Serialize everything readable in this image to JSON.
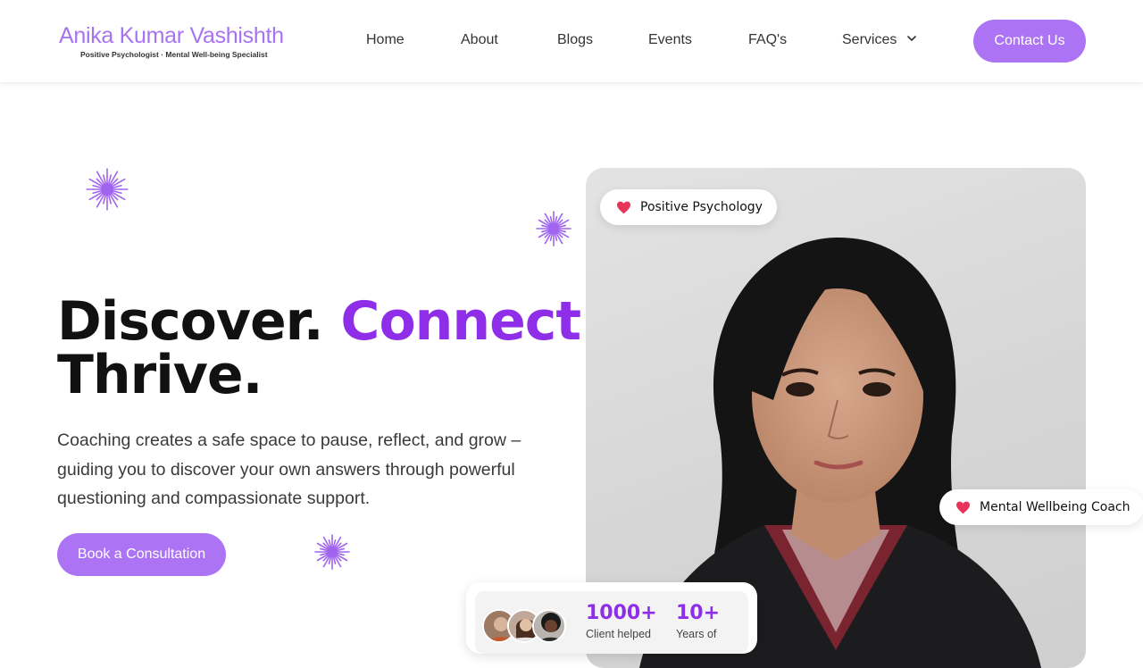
{
  "brand": {
    "name": "Anika Kumar Vashishth",
    "tagline": "Positive Psychologist · Mental Well-being Specialist"
  },
  "nav": {
    "items": [
      "Home",
      "About",
      "Blogs",
      "Events",
      "FAQ's",
      "Services"
    ],
    "contact_label": "Contact Us"
  },
  "hero": {
    "headline_part1": "Discover.",
    "headline_part2": "Connect.",
    "headline_part3": "Thrive.",
    "description": "Coaching creates a safe space to pause, reflect, and grow – guiding you to discover your own answers through powerful questioning and compassionate support.",
    "cta_label": "Book a Consultation"
  },
  "badges": {
    "top": "Positive Psychology",
    "side": "Mental Wellbeing Coach"
  },
  "stats": {
    "clients_value": "1000+",
    "clients_label": "Client helped",
    "years_value": "10+",
    "years_label": "Years of"
  },
  "colors": {
    "accent": "#ac74f4",
    "headline_accent": "#8f2ee8",
    "heart": "#e8345a"
  },
  "icons": [
    "sparkle-icon",
    "heart-icon",
    "chevron-down-icon"
  ]
}
